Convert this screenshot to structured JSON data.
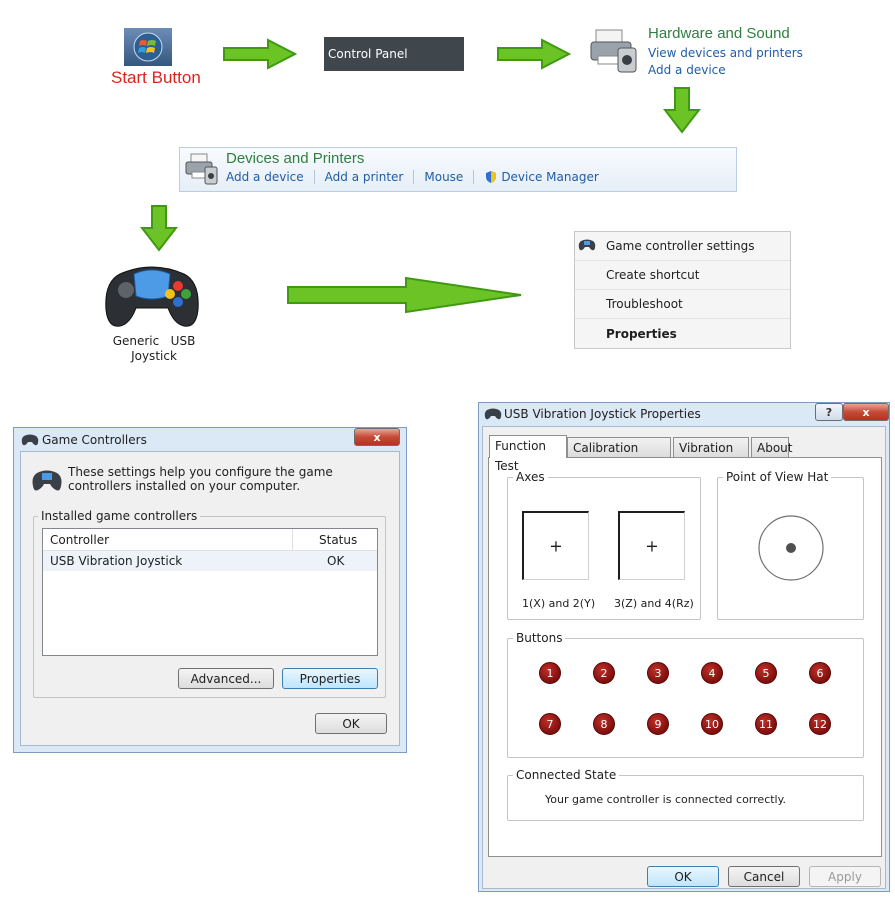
{
  "flow": {
    "start_label": "Start Button",
    "control_panel": "Control Panel",
    "hardware_sound": {
      "title": "Hardware and Sound",
      "link1": "View devices and printers",
      "link2": "Add a device"
    }
  },
  "devices_printers": {
    "title": "Devices and Printers",
    "links": [
      "Add a device",
      "Add a printer",
      "Mouse",
      "Device Manager"
    ]
  },
  "device": {
    "label_line1": "Generic   USB",
    "label_line2": "Joystick"
  },
  "context_menu": {
    "items": [
      "Game controller settings",
      "Create shortcut",
      "Troubleshoot",
      "Properties"
    ]
  },
  "game_controllers": {
    "title": "Game Controllers",
    "description": "These settings help you configure the game controllers installed on your computer.",
    "group_label": "Installed game controllers",
    "columns": [
      "Controller",
      "Status"
    ],
    "rows": [
      {
        "controller": "USB Vibration Joystick",
        "status": "OK"
      }
    ],
    "advanced_btn": "Advanced...",
    "properties_btn": "Properties",
    "ok_btn": "OK",
    "close_glyph": "x"
  },
  "properties": {
    "title": "USB Vibration Joystick Properties",
    "help_glyph": "?",
    "close_glyph": "x",
    "tabs": [
      "Function Test",
      "Calibration Function",
      "Vibration Test",
      "About"
    ],
    "active_tab": "Function Test",
    "axes_label": "Axes",
    "axis1_label": "1(X) and 2(Y)",
    "axis2_label": "3(Z) and 4(Rz)",
    "pov_label": "Point of View Hat",
    "buttons_label": "Buttons",
    "buttons": [
      "1",
      "2",
      "3",
      "4",
      "5",
      "6",
      "7",
      "8",
      "9",
      "10",
      "11",
      "12"
    ],
    "connected_label": "Connected State",
    "connected_text": "Your game controller is connected correctly.",
    "ok_btn": "OK",
    "cancel_btn": "Cancel",
    "apply_btn": "Apply"
  },
  "colors": {
    "arrow_green": "#6cc326",
    "link_blue": "#1f5da8",
    "title_green": "#2f7f3f",
    "start_red": "#d8261c",
    "button_red": "#9b1512"
  }
}
